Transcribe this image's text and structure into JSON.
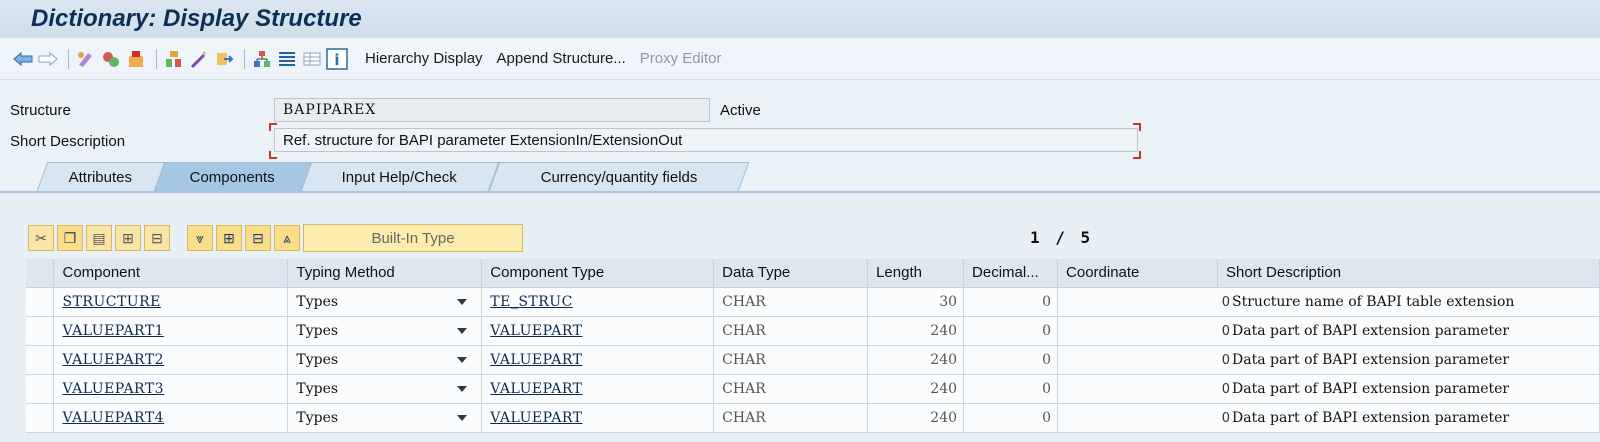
{
  "title": "Dictionary: Display Structure",
  "toolbar": {
    "icons": [
      "back-arrow-icon",
      "forward-arrow-icon",
      "other-object-icon",
      "display-change-icon",
      "activate-icon",
      "where-used-icon",
      "object-list-icon",
      "navigation-icon",
      "hierarchy-icon",
      "display-object-list-icon",
      "documentation-icon",
      "info-icon"
    ],
    "hierarchy_display": "Hierarchy Display",
    "append_structure": "Append Structure...",
    "proxy_editor": "Proxy Editor"
  },
  "header": {
    "structure_label": "Structure",
    "structure_value": "BAPIPAREX",
    "status": "Active",
    "short_desc_label": "Short Description",
    "short_desc_value": "Ref. structure for BAPI parameter ExtensionIn/ExtensionOut"
  },
  "tabs": [
    {
      "label": "Attributes",
      "active": false
    },
    {
      "label": "Components",
      "active": true
    },
    {
      "label": "Input Help/Check",
      "active": false
    },
    {
      "label": "Currency/quantity fields",
      "active": false
    }
  ],
  "grid_toolbar": {
    "builtin_type": "Built-In Type",
    "pager": "1 / 5"
  },
  "table": {
    "columns": [
      "Component",
      "Typing Method",
      "Component Type",
      "Data Type",
      "Length",
      "Decimal...",
      "Coordinate",
      "Short Description"
    ],
    "rows": [
      {
        "component": "STRUCTURE",
        "typing": "Types",
        "comp_type": "TE_STRUC",
        "data_type": "CHAR",
        "length": "30",
        "decimals": "0",
        "coordinate": "0",
        "desc": "Structure name of  BAPI table extension"
      },
      {
        "component": "VALUEPART1",
        "typing": "Types",
        "comp_type": "VALUEPART",
        "data_type": "CHAR",
        "length": "240",
        "decimals": "0",
        "coordinate": "0",
        "desc": "Data part of BAPI extension parameter"
      },
      {
        "component": "VALUEPART2",
        "typing": "Types",
        "comp_type": "VALUEPART",
        "data_type": "CHAR",
        "length": "240",
        "decimals": "0",
        "coordinate": "0",
        "desc": "Data part of BAPI extension parameter"
      },
      {
        "component": "VALUEPART3",
        "typing": "Types",
        "comp_type": "VALUEPART",
        "data_type": "CHAR",
        "length": "240",
        "decimals": "0",
        "coordinate": "0",
        "desc": "Data part of BAPI extension parameter"
      },
      {
        "component": "VALUEPART4",
        "typing": "Types",
        "comp_type": "VALUEPART",
        "data_type": "CHAR",
        "length": "240",
        "decimals": "0",
        "coordinate": "0",
        "desc": "Data part of BAPI extension parameter"
      }
    ]
  }
}
